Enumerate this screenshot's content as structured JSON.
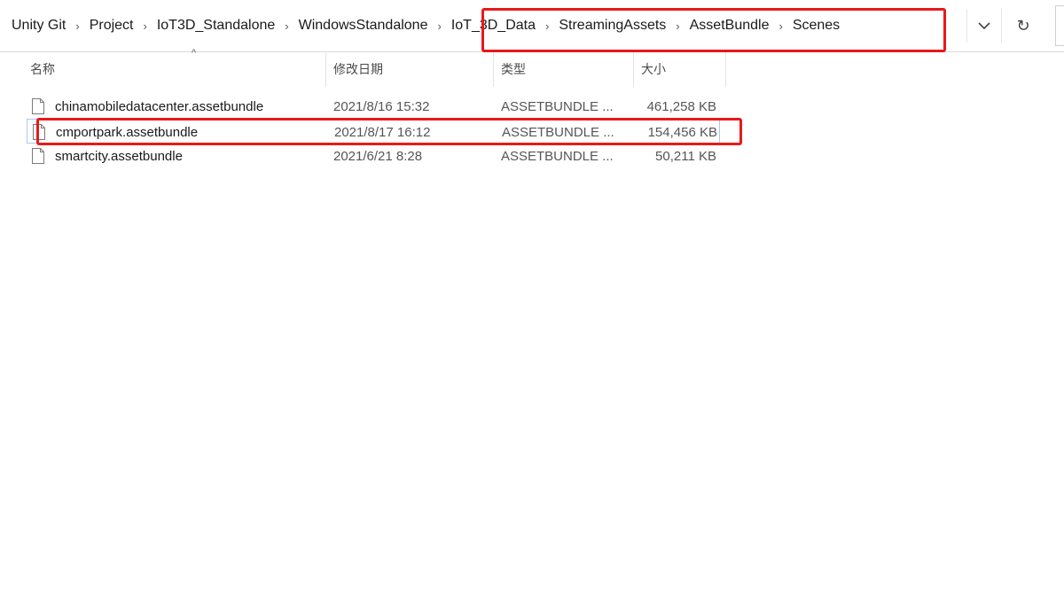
{
  "breadcrumb": {
    "items": [
      "Unity Git",
      "Project",
      "IoT3D_Standalone",
      "WindowsStandalone",
      "IoT_3D_Data",
      "StreamingAssets",
      "AssetBundle",
      "Scenes"
    ],
    "separator": "›"
  },
  "address_bar": {
    "dropdown_icon": "chevron-down-icon",
    "refresh_icon": "refresh-icon",
    "refresh_glyph": "↻"
  },
  "columns": {
    "name": "名称",
    "date": "修改日期",
    "type": "类型",
    "size": "大小",
    "sort_indicator": "^"
  },
  "files": [
    {
      "name": "chinamobiledatacenter.assetbundle",
      "date": "2021/8/16 15:32",
      "type": "ASSETBUNDLE ...",
      "size": "461,258 KB"
    },
    {
      "name": "cmportpark.assetbundle",
      "date": "2021/8/17 16:12",
      "type": "ASSETBUNDLE ...",
      "size": "154,456 KB"
    },
    {
      "name": "smartcity.assetbundle",
      "date": "2021/6/21 8:28",
      "type": "ASSETBUNDLE ...",
      "size": "50,211 KB"
    }
  ],
  "annotation_color": "#e8191a"
}
